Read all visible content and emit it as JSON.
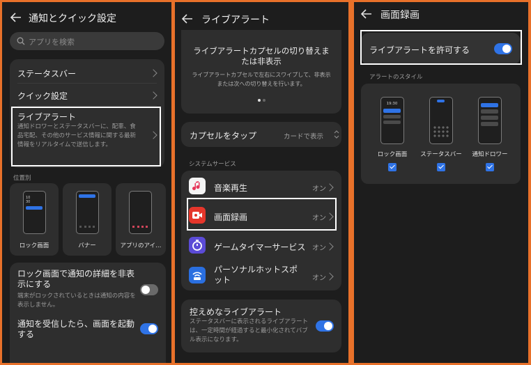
{
  "panel1": {
    "title": "通知とクイック設定",
    "search_placeholder": "アプリを検索",
    "menu": [
      {
        "label": "ステータスバー"
      },
      {
        "label": "クイック設定"
      }
    ],
    "live_alert": {
      "label": "ライブアラート",
      "desc": "通知ドロワーとステータスバーに、配車、食品宅配、その他のサービス情報に関する最新情報をリアルタイムで送信します。"
    },
    "position_label": "位置別",
    "positions": [
      {
        "label": "ロック画面",
        "time": "10\n30"
      },
      {
        "label": "バナー"
      },
      {
        "label": "アプリのアイ…"
      }
    ],
    "lock_hide": {
      "label": "ロック画面で通知の詳細を非表示にする",
      "desc": "端末がロックされているときは通知の内容を表示しません。",
      "enabled": false
    },
    "wake_screen": {
      "label": "通知を受信したら、画面を起動する",
      "enabled": true
    }
  },
  "panel2": {
    "title": "ライブアラート",
    "carousel": {
      "heading": "ライブアラートカプセルの切り替えまたは非表示",
      "desc": "ライブアラートカプセルで左右にスワイプして、非表示または次への切り替えを行います。"
    },
    "capsule_tap": {
      "label": "カプセルをタップ",
      "value": "カードで表示"
    },
    "section_label": "システムサービス",
    "services": [
      {
        "label": "音楽再生",
        "status": "オン",
        "icon": "music-icon",
        "color": "#f4f4f4"
      },
      {
        "label": "画面録画",
        "status": "オン",
        "icon": "screen-record-icon",
        "color": "#e5362b"
      },
      {
        "label": "ゲームタイマーサービス",
        "status": "オン",
        "icon": "game-timer-icon",
        "color": "#5b4bd6"
      },
      {
        "label": "パーソナルホットスポット",
        "status": "オン",
        "icon": "hotspot-icon",
        "color": "#2a6fe0"
      }
    ],
    "subtle_alert": {
      "label": "控えめなライブアラート",
      "desc": "ステータスバーに表示されるライブアラートは、一定時間が経過すると最小化されてバブル表示になります。",
      "enabled": true
    }
  },
  "panel3": {
    "title": "画面録画",
    "allow": {
      "label": "ライブアラートを許可する",
      "enabled": true
    },
    "style_label": "アラートのスタイル",
    "styles": [
      {
        "label": "ロック画面",
        "time": "19:30",
        "checked": true
      },
      {
        "label": "ステータスバー",
        "checked": true
      },
      {
        "label": "通知ドロワー",
        "checked": true
      }
    ]
  }
}
